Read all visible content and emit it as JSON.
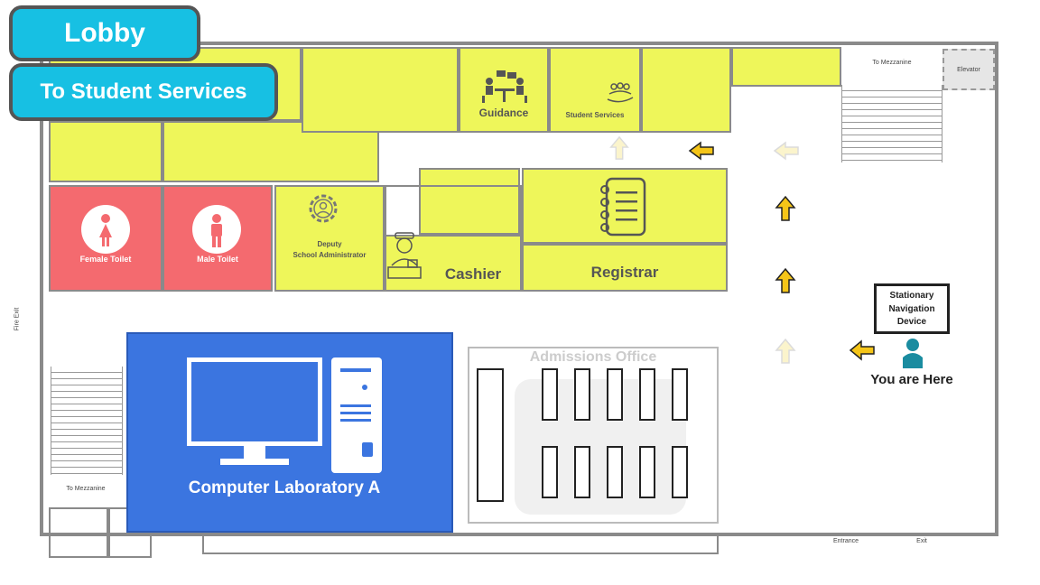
{
  "tags": {
    "lobby": "Lobby",
    "to_student_services": "To Student Services"
  },
  "rooms": {
    "guidance": "Guidance",
    "student_services": "Student Services",
    "female_toilet": "Female Toilet",
    "male_toilet": "Male Toilet",
    "deputy_line1": "Deputy",
    "deputy_line2": "School Administrator",
    "cashier": "Cashier",
    "registrar": "Registrar",
    "computer_lab": "Computer Laboratory A",
    "admissions": "Admissions Office",
    "elevator": "Elevator"
  },
  "labels": {
    "to_mezzanine_top": "To Mezzanine",
    "to_mezzanine_bottom": "To Mezzanine",
    "fire_exit": "Fire Exit",
    "entrance": "Entrance",
    "exit": "Exit"
  },
  "device": {
    "line1": "Stationary",
    "line2": "Navigation",
    "line3": "Device",
    "you_are_here": "You are Here"
  },
  "colors": {
    "office": "#eef65a",
    "toilet": "#f46a6f",
    "lab": "#3b75e0",
    "tag": "#17c0e3",
    "arrow": "#f5c518",
    "person": "#1a8ca0"
  },
  "icons": [
    "meeting-icon",
    "group-hand-icon",
    "female-icon",
    "male-icon",
    "gear-person-icon",
    "cashier-icon",
    "notebook-icon",
    "monitor-icon",
    "pc-tower-icon",
    "person-icon",
    "arrow-icon"
  ]
}
